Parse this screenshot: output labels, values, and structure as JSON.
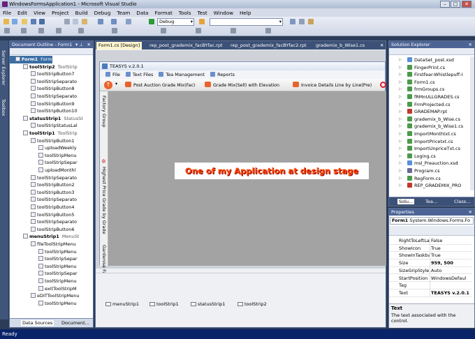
{
  "window": {
    "title": "WindowsFormsApplication1 - Microsoft Visual Studio"
  },
  "menu": [
    "File",
    "Edit",
    "View",
    "Project",
    "Build",
    "Debug",
    "Team",
    "Data",
    "Format",
    "Tools",
    "Test",
    "Window",
    "Help"
  ],
  "toolbar": {
    "config": "Debug",
    "search_value": ""
  },
  "left_tabs": [
    "Server Explorer",
    "Toolbox"
  ],
  "outline": {
    "title": "Document Outline - Form1",
    "rows": [
      {
        "label": "Form1",
        "type": "Form",
        "level": 0,
        "selected": true
      },
      {
        "label": "toolStrip2",
        "type": "ToolStrip",
        "level": 1
      },
      {
        "label": "toolStripButton7",
        "level": 2
      },
      {
        "label": "toolStripSeparato",
        "level": 2
      },
      {
        "label": "toolStripButton8",
        "level": 2
      },
      {
        "label": "toolStripSeparato",
        "level": 2
      },
      {
        "label": "toolStripButton9",
        "level": 2
      },
      {
        "label": "toolStripButton10",
        "level": 2
      },
      {
        "label": "statusStrip1",
        "type": "StatusSt",
        "level": 1
      },
      {
        "label": "toolStripStatusLal",
        "level": 2
      },
      {
        "label": "toolStrip1",
        "type": "ToolStrip",
        "level": 1
      },
      {
        "label": "toolStripButton1",
        "level": 2
      },
      {
        "label": "uploadWeekly",
        "level": 3
      },
      {
        "label": "toolStripMenu",
        "level": 3
      },
      {
        "label": "toolStripSepar",
        "level": 3
      },
      {
        "label": "uploadMonthl",
        "level": 3
      },
      {
        "label": "toolStripSeparato",
        "level": 2
      },
      {
        "label": "toolStripButton2",
        "level": 2
      },
      {
        "label": "toolStripButton3",
        "level": 2
      },
      {
        "label": "toolStripSeparato",
        "level": 2
      },
      {
        "label": "toolStripButton4",
        "level": 2
      },
      {
        "label": "toolStripButton5",
        "level": 2
      },
      {
        "label": "toolStripSeparato",
        "level": 2
      },
      {
        "label": "toolStripButton6",
        "level": 2
      },
      {
        "label": "menuStrip1",
        "type": "MenuSt",
        "level": 1
      },
      {
        "label": "fileToolStripMenu",
        "level": 2
      },
      {
        "label": "toolStripMenu",
        "level": 3
      },
      {
        "label": "toolStripSepar",
        "level": 3
      },
      {
        "label": "toolStripMenu",
        "level": 3
      },
      {
        "label": "toolStripSepar",
        "level": 3
      },
      {
        "label": "toolStripMenu",
        "level": 3
      },
      {
        "label": "exitToolStripM",
        "level": 3
      },
      {
        "label": "eDITToolStripMenu",
        "level": 2
      },
      {
        "label": "toolStripMenu",
        "level": 3
      }
    ],
    "bottom_tabs": [
      "Data Sources",
      "Document..."
    ]
  },
  "doc_tabs": [
    "Form1.cs [Design]",
    "rep_post_grademix_facBYfac.rpt",
    "rep_post_grademix_facBYfac2.rpt",
    "grademix_b_Wise1.cs"
  ],
  "form": {
    "title": "TEASYS v.2.0.1",
    "menu": [
      "File",
      "Text Files",
      "Tea Management",
      "Reports"
    ],
    "toolstrip": [
      "Post Auction Grade Mix(Fac)",
      "Grade Mix(Sell) with Elevation",
      "Invoice Details Line by Line(Pre)"
    ],
    "side_strip": [
      "Factory Group",
      "Highest Price Grade by Grade",
      "Gardenise Fac"
    ],
    "banner": "One of my Application at design stage"
  },
  "tray": [
    "menuStrip1",
    "toolStrip1",
    "statusStrip1",
    "toolStrip2"
  ],
  "solution": {
    "title": "Solution Explorer",
    "files": [
      {
        "name": "DataSet_post.xsd",
        "color": "#5b8fd6"
      },
      {
        "name": "FingerPrint.cs",
        "color": "#4a9a4a"
      },
      {
        "name": "Firstfear-Whistlepuff-I",
        "color": "#4a9a4a"
      },
      {
        "name": "Form1.cs",
        "color": "#4a9a4a"
      },
      {
        "name": "frmGroups.cs",
        "color": "#4a9a4a"
      },
      {
        "name": "fRMnULLGRADES.cs",
        "color": "#4a9a4a"
      },
      {
        "name": "FrmProjected.cs",
        "color": "#4a9a4a"
      },
      {
        "name": "GRADEMAP.rpt",
        "color": "#c0392b"
      },
      {
        "name": "grademix_b_Wise.cs",
        "color": "#4a9a4a"
      },
      {
        "name": "grademix_b_Wise1.cs",
        "color": "#4a9a4a"
      },
      {
        "name": "ImportMonthtxt.cs",
        "color": "#4a9a4a"
      },
      {
        "name": "ImportPricetxt.cs",
        "color": "#4a9a4a"
      },
      {
        "name": "ImportUnpriceTxt.cs",
        "color": "#4a9a4a"
      },
      {
        "name": "Loging.cs",
        "color": "#4a9a4a"
      },
      {
        "name": "msl_Preauction.xsd",
        "color": "#5b8fd6"
      },
      {
        "name": "Program.cs",
        "color": "#6a6a9a"
      },
      {
        "name": "RegForm.cs",
        "color": "#4a9a4a"
      },
      {
        "name": "REP_GRADEMIX_PRO",
        "color": "#c0392b"
      }
    ],
    "tabs": [
      "Solu...",
      "Tea...",
      "Class..."
    ]
  },
  "properties": {
    "title": "Properties",
    "object": "Form1",
    "object_type": "System.Windows.Forms.Fo",
    "rows": [
      {
        "name": "RightToLeftLa",
        "value": "False"
      },
      {
        "name": "ShowIcon",
        "value": "True"
      },
      {
        "name": "ShowInTaskba",
        "value": "True"
      },
      {
        "name": "Size",
        "value": "959, 500",
        "bold": true
      },
      {
        "name": "SizeGripStyle",
        "value": "Auto"
      },
      {
        "name": "StartPosition",
        "value": "WindowsDefaul"
      },
      {
        "name": "Tag",
        "value": ""
      },
      {
        "name": "Text",
        "value": "TEASYS v.2.0.1",
        "bold": true
      }
    ],
    "desc_title": "Text",
    "desc": "The text associated with the control."
  },
  "status": "Ready"
}
